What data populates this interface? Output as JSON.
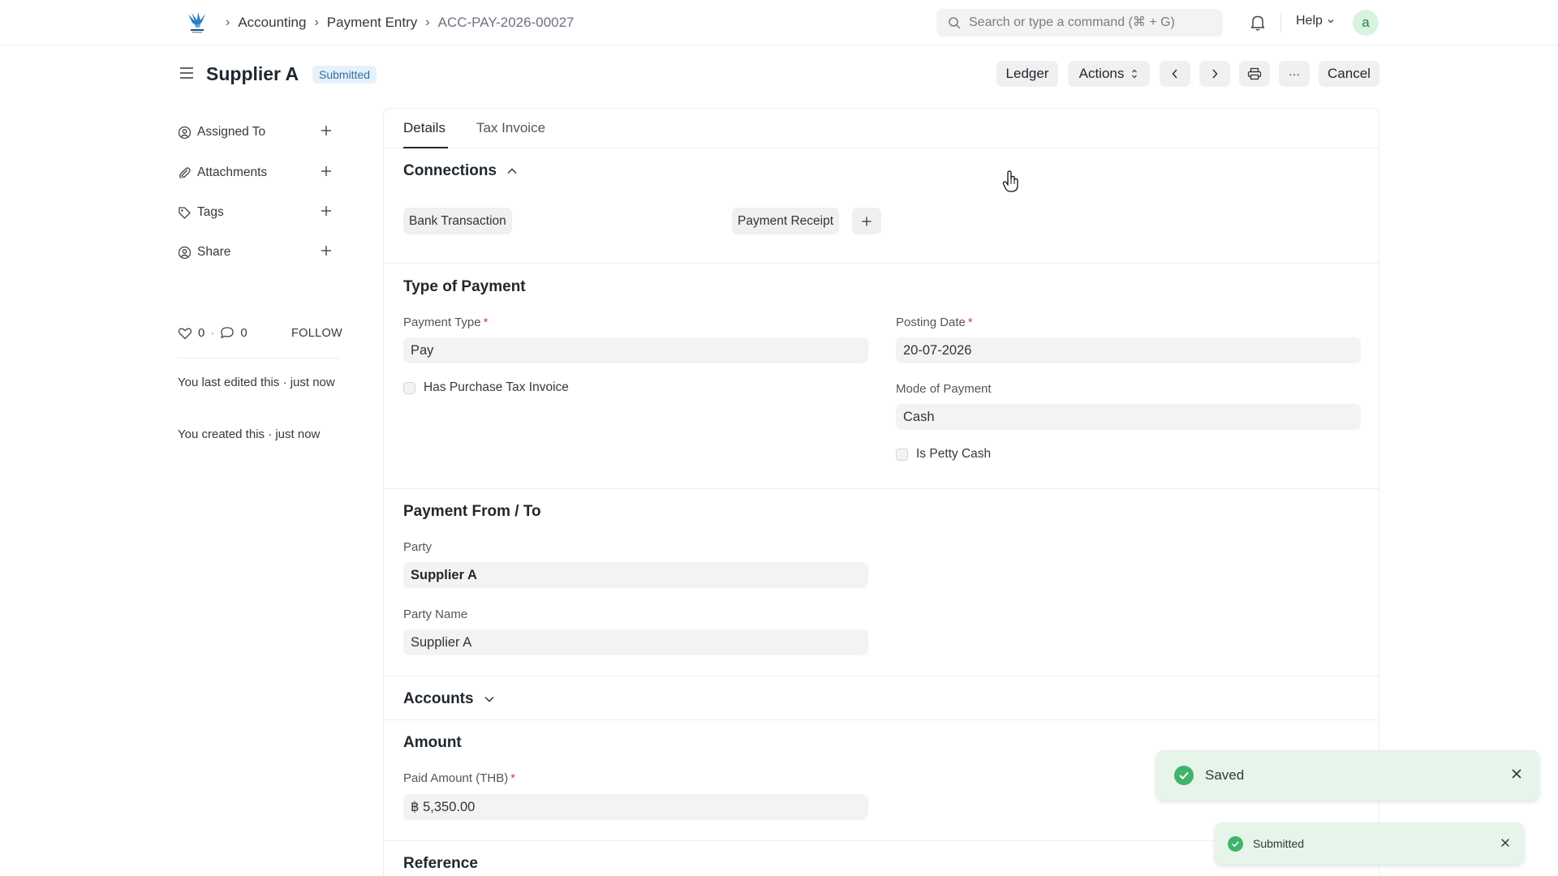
{
  "navbar": {
    "breadcrumbs": [
      "Accounting",
      "Payment Entry",
      "ACC-PAY-2026-00027"
    ],
    "search_placeholder": "Search or type a command (⌘ + G)",
    "help_label": "Help",
    "avatar_letter": "a"
  },
  "header": {
    "title": "Supplier A",
    "status": "Submitted",
    "buttons": {
      "ledger": "Ledger",
      "actions": "Actions",
      "more": "···",
      "cancel": "Cancel"
    }
  },
  "sidebar": {
    "items": [
      {
        "label": "Assigned To",
        "icon": "assign-icon"
      },
      {
        "label": "Attachments",
        "icon": "paperclip-icon"
      },
      {
        "label": "Tags",
        "icon": "tag-icon"
      },
      {
        "label": "Share",
        "icon": "share-icon"
      }
    ],
    "likes_count": "0",
    "comments_count": "0",
    "dot": "·",
    "follow_label": "FOLLOW",
    "last_edited": "You last edited this · just now",
    "created": "You created this · just now"
  },
  "tabs": [
    "Details",
    "Tax Invoice"
  ],
  "connections": {
    "title": "Connections",
    "links": [
      "Bank Transaction",
      "Payment Receipt"
    ]
  },
  "type_of_payment": {
    "title": "Type of Payment",
    "payment_type_label": "Payment Type",
    "payment_type_value": "Pay",
    "has_purchase_tax_invoice_label": "Has Purchase Tax Invoice",
    "has_purchase_tax_invoice_checked": false,
    "posting_date_label": "Posting Date",
    "posting_date_value": "20-07-2026",
    "mode_of_payment_label": "Mode of Payment",
    "mode_of_payment_value": "Cash",
    "is_petty_cash_label": "Is Petty Cash",
    "is_petty_cash_checked": false
  },
  "payment_from_to": {
    "title": "Payment From / To",
    "party_label": "Party",
    "party_value": "Supplier A",
    "party_name_label": "Party Name",
    "party_name_value": "Supplier A"
  },
  "accounts": {
    "title": "Accounts"
  },
  "amount": {
    "title": "Amount",
    "paid_amount_label": "Paid Amount (THB)",
    "paid_amount_value": "฿ 5,350.00"
  },
  "reference": {
    "title": "Reference"
  },
  "required_marker": "*",
  "toasts": [
    {
      "message": "Saved"
    },
    {
      "message": "Submitted"
    }
  ],
  "colors": {
    "accent_badge_bg": "#e8f1fb",
    "accent_badge_text": "#2a6ea8",
    "toast_bg": "#e6f4ea",
    "toast_icon": "#3fb46a",
    "required": "#e03636"
  }
}
